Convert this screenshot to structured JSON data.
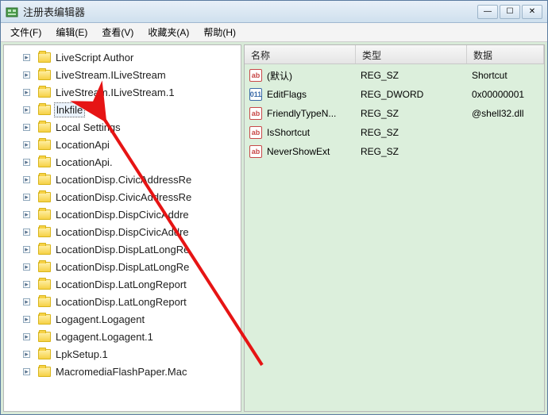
{
  "window": {
    "title": "注册表编辑器"
  },
  "menus": {
    "file": "文件(F)",
    "edit": "编辑(E)",
    "view": "查看(V)",
    "favorites": "收藏夹(A)",
    "help": "帮助(H)"
  },
  "win_ctrl": {
    "min": "—",
    "max": "☐",
    "close": "✕"
  },
  "tree": {
    "items": [
      {
        "label": "LiveScript Author",
        "selected": false
      },
      {
        "label": "LiveStream.ILiveStream",
        "selected": false
      },
      {
        "label": "LiveStream.ILiveStream.1",
        "selected": false
      },
      {
        "label": "lnkfile",
        "selected": true
      },
      {
        "label": "Local Settings",
        "selected": false
      },
      {
        "label": "LocationApi",
        "selected": false
      },
      {
        "label": "LocationApi.",
        "selected": false
      },
      {
        "label": "LocationDisp.CivicAddressRe",
        "selected": false
      },
      {
        "label": "LocationDisp.CivicAddressRe",
        "selected": false
      },
      {
        "label": "LocationDisp.DispCivicAddre",
        "selected": false
      },
      {
        "label": "LocationDisp.DispCivicAddre",
        "selected": false
      },
      {
        "label": "LocationDisp.DispLatLongRe",
        "selected": false
      },
      {
        "label": "LocationDisp.DispLatLongRe",
        "selected": false
      },
      {
        "label": "LocationDisp.LatLongReport",
        "selected": false
      },
      {
        "label": "LocationDisp.LatLongReport",
        "selected": false
      },
      {
        "label": "Logagent.Logagent",
        "selected": false
      },
      {
        "label": "Logagent.Logagent.1",
        "selected": false
      },
      {
        "label": "LpkSetup.1",
        "selected": false
      },
      {
        "label": "MacromediaFlashPaper.Mac",
        "selected": false
      }
    ]
  },
  "list": {
    "headers": {
      "name": "名称",
      "type": "类型",
      "data": "数据"
    },
    "rows": [
      {
        "icon": "str",
        "name": "(默认)",
        "type": "REG_SZ",
        "data": "Shortcut"
      },
      {
        "icon": "bin",
        "name": "EditFlags",
        "type": "REG_DWORD",
        "data": "0x00000001"
      },
      {
        "icon": "str",
        "name": "FriendlyTypeN...",
        "type": "REG_SZ",
        "data": "@shell32.dll"
      },
      {
        "icon": "str",
        "name": "IsShortcut",
        "type": "REG_SZ",
        "data": ""
      },
      {
        "icon": "str",
        "name": "NeverShowExt",
        "type": "REG_SZ",
        "data": ""
      }
    ]
  },
  "icons": {
    "str_glyph": "ab",
    "bin_glyph": "011"
  }
}
